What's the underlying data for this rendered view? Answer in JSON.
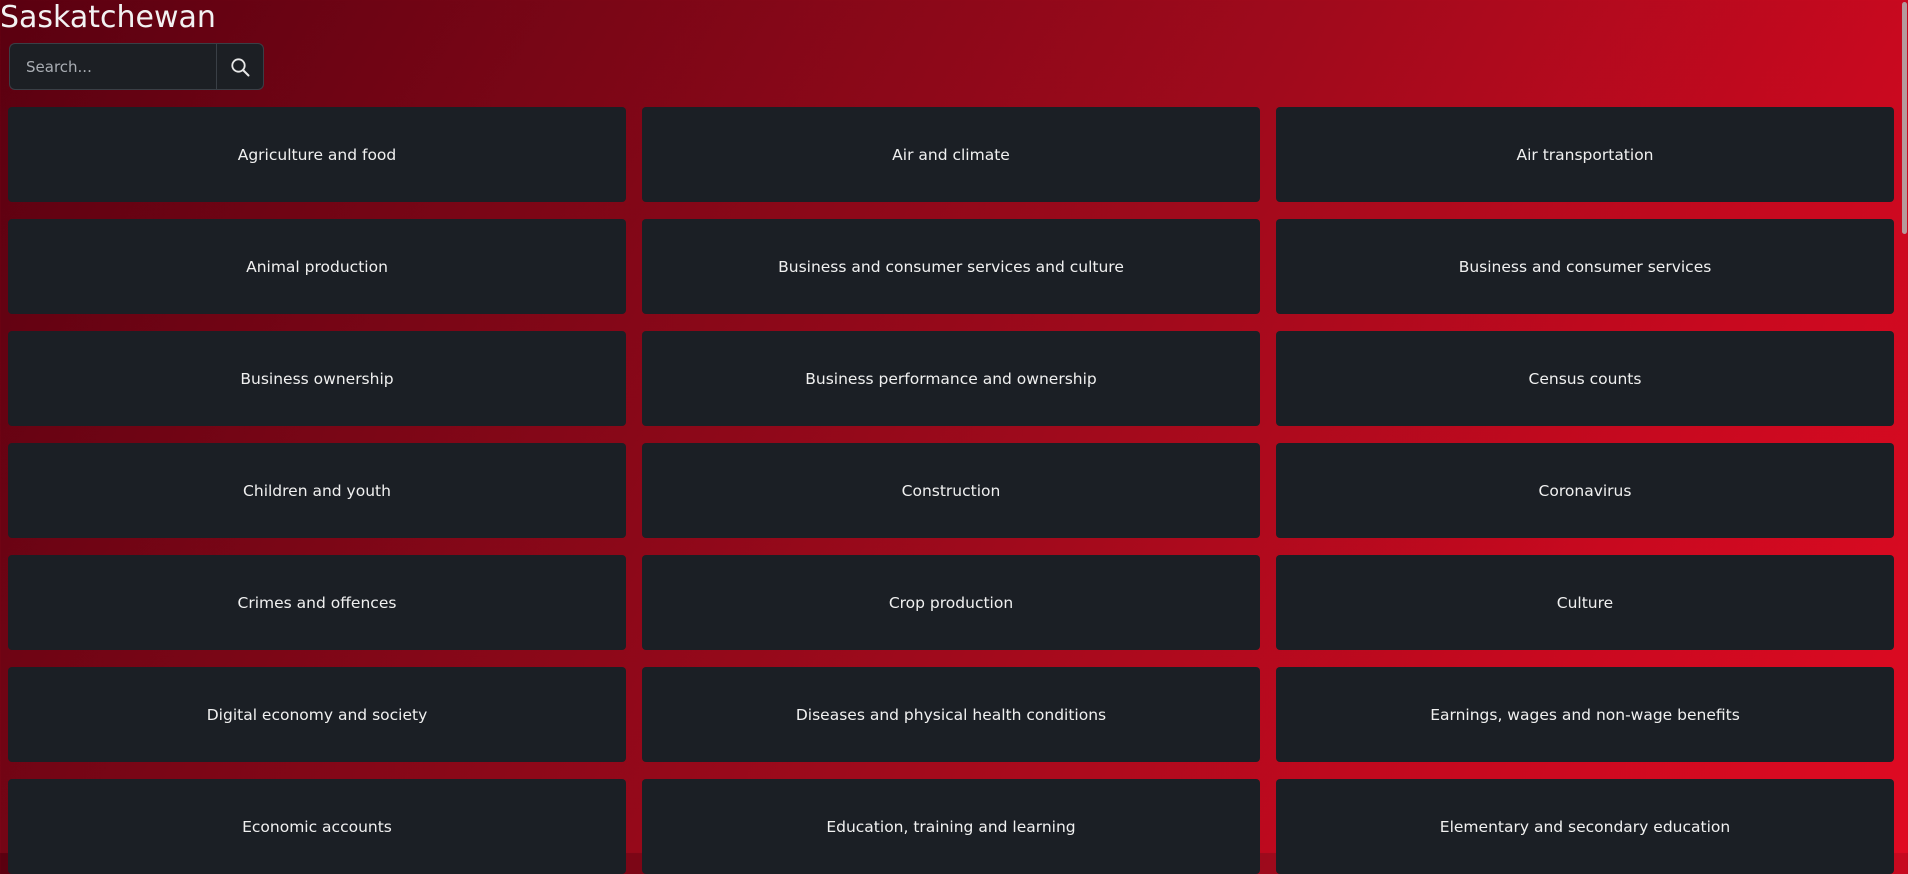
{
  "page": {
    "title": "Saskatchewan"
  },
  "search": {
    "placeholder": "Search...",
    "value": "",
    "button_icon": "search-icon"
  },
  "colors": {
    "background_gradient_start": "#5a0010",
    "background_gradient_end": "#e00a22",
    "tile_background": "#1b1f25",
    "tile_text": "#f0f0f0"
  },
  "topics": [
    "Agriculture and food",
    "Air and climate",
    "Air transportation",
    "Animal production",
    "Business and consumer services and culture",
    "Business and consumer services",
    "Business ownership",
    "Business performance and ownership",
    "Census counts",
    "Children and youth",
    "Construction",
    "Coronavirus",
    "Crimes and offences",
    "Crop production",
    "Culture",
    "Digital economy and society",
    "Diseases and physical health conditions",
    "Earnings, wages and non-wage benefits",
    "Economic accounts",
    "Education, training and learning",
    "Elementary and secondary education"
  ]
}
